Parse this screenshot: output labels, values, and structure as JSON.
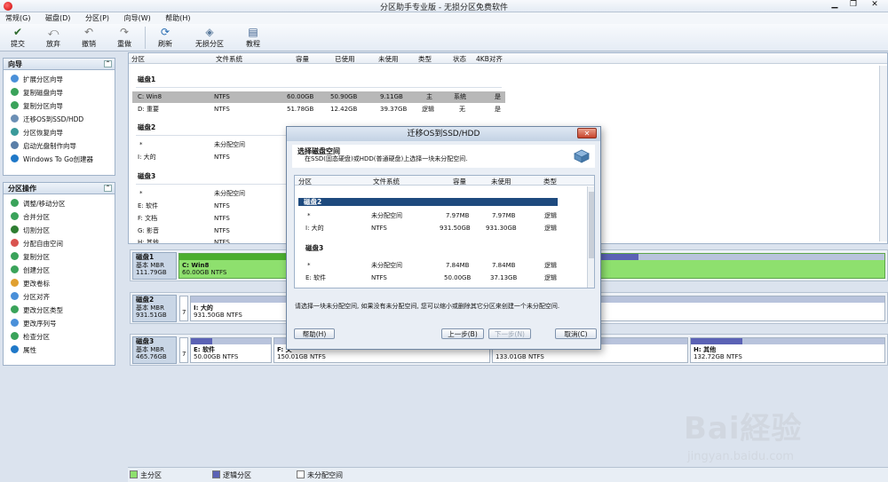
{
  "window": {
    "title": "分区助手专业版 - 无损分区免费软件",
    "controls": [
      "▁",
      "❐",
      "✕"
    ]
  },
  "menu": [
    "常规(G)",
    "磁盘(D)",
    "分区(P)",
    "向导(W)",
    "帮助(H)"
  ],
  "toolbar": [
    {
      "label": "提交",
      "icon": "check-icon"
    },
    {
      "label": "放弃",
      "icon": "discard-icon"
    },
    {
      "label": "撤销",
      "icon": "undo-icon"
    },
    {
      "label": "重做",
      "icon": "redo-icon"
    },
    {
      "label": "刷新",
      "icon": "refresh-icon"
    },
    {
      "label": "无损分区",
      "icon": "partition-icon"
    },
    {
      "label": "教程",
      "icon": "tutorial-icon"
    }
  ],
  "wizard_panel": {
    "title": "向导",
    "items": [
      "扩展分区向导",
      "复制磁盘向导",
      "复制分区向导",
      "迁移OS到SSD/HDD",
      "分区恢复向导",
      "启动光盘制作向导",
      "Windows To Go创建器"
    ]
  },
  "ops_panel": {
    "title": "分区操作",
    "items": [
      "调整/移动分区",
      "合并分区",
      "切割分区",
      "分配自由空间",
      "复制分区",
      "创建分区",
      "更改卷标",
      "分区对齐",
      "更改分区类型",
      "更改序列号",
      "检查分区",
      "属性"
    ]
  },
  "list_header": [
    "分区",
    "文件系统",
    "容量",
    "已使用",
    "未使用",
    "类型",
    "状态",
    "4KB对齐"
  ],
  "disks": [
    {
      "name": "磁盘1",
      "rows": [
        {
          "part": "C: Win8",
          "fs": "NTFS",
          "cap": "60.00GB",
          "used": "50.90GB",
          "free": "9.11GB",
          "type": "主",
          "status": "系统",
          "align": "是",
          "selected": true
        },
        {
          "part": "D: 重要",
          "fs": "NTFS",
          "cap": "51.78GB",
          "used": "12.42GB",
          "free": "39.37GB",
          "type": "逻辑",
          "status": "无",
          "align": "是"
        }
      ]
    },
    {
      "name": "磁盘2",
      "rows": [
        {
          "part": "*",
          "fs": "未分配空间",
          "cap": "",
          "used": "",
          "free": "",
          "type": "",
          "status": "",
          "align": ""
        },
        {
          "part": "I: 大的",
          "fs": "NTFS",
          "cap": "",
          "used": "",
          "free": "",
          "type": "",
          "status": "",
          "align": ""
        }
      ]
    },
    {
      "name": "磁盘3",
      "rows": [
        {
          "part": "*",
          "fs": "未分配空间",
          "cap": "",
          "used": "",
          "free": "",
          "type": "",
          "status": "",
          "align": ""
        },
        {
          "part": "E: 软件",
          "fs": "NTFS",
          "cap": "",
          "used": "",
          "free": "",
          "type": "",
          "status": "",
          "align": ""
        },
        {
          "part": "F: 文档",
          "fs": "NTFS",
          "cap": "",
          "used": "",
          "free": "",
          "type": "",
          "status": "",
          "align": ""
        },
        {
          "part": "G: 影音",
          "fs": "NTFS",
          "cap": "",
          "used": "",
          "free": "",
          "type": "",
          "status": "",
          "align": ""
        },
        {
          "part": "H: 其他",
          "fs": "NTFS",
          "cap": "",
          "used": "",
          "free": "",
          "type": "",
          "status": "",
          "align": ""
        }
      ]
    }
  ],
  "diskmap": [
    {
      "name": "磁盘1",
      "kind": "基本 MBR",
      "size": "111.79GB",
      "parts": [
        {
          "label": "C: Win8",
          "info": "60.00GB NTFS"
        }
      ]
    },
    {
      "name": "磁盘2",
      "kind": "基本 MBR",
      "size": "931.51GB",
      "unalloc": "7",
      "parts": [
        {
          "label": "I: 大的",
          "info": "931.50GB NTFS"
        }
      ]
    },
    {
      "name": "磁盘3",
      "kind": "基本 MBR",
      "size": "465.76GB",
      "unalloc": "7",
      "parts": [
        {
          "label": "E: 软件",
          "info": "50.00GB NTFS"
        },
        {
          "label": "F: 文",
          "info": "150.01GB NTFS"
        },
        {
          "label": "",
          "info": "133.01GB NTFS"
        },
        {
          "label": "H: 其他",
          "info": "132.72GB NTFS"
        }
      ]
    }
  ],
  "legend": [
    "主分区",
    "逻辑分区",
    "未分配空间"
  ],
  "dialog": {
    "title": "迁移OS到SSD/HDD",
    "close": "✕",
    "heading": "选择磁盘空间",
    "subheading": "在SSD(固态硬盘)或HDD(普通硬盘)上选择一块未分配空间.",
    "columns": [
      "分区",
      "文件系统",
      "容量",
      "未使用",
      "类型"
    ],
    "groups": [
      {
        "name": "磁盘2",
        "rows": [
          {
            "part": "*",
            "fs": "未分配空间",
            "cap": "7.97MB",
            "free": "7.97MB",
            "type": "逻辑"
          },
          {
            "part": "I: 大的",
            "fs": "NTFS",
            "cap": "931.50GB",
            "free": "931.30GB",
            "type": "逻辑"
          }
        ]
      },
      {
        "name": "磁盘3",
        "rows": [
          {
            "part": "*",
            "fs": "未分配空间",
            "cap": "7.84MB",
            "free": "7.84MB",
            "type": "逻辑"
          },
          {
            "part": "E: 软件",
            "fs": "NTFS",
            "cap": "50.00GB",
            "free": "37.13GB",
            "type": "逻辑"
          }
        ]
      }
    ],
    "note": "请选择一块未分配空间, 如果没有未分配空间, 您可以缩小或删除其它分区来创建一个未分配空间.",
    "buttons": {
      "help": "帮助(H)",
      "prev": "上一步(B)",
      "next": "下一步(N)",
      "cancel": "取消(C)"
    }
  },
  "watermark": {
    "big": "Bai経验",
    "small": "jingyan.baidu.com"
  }
}
